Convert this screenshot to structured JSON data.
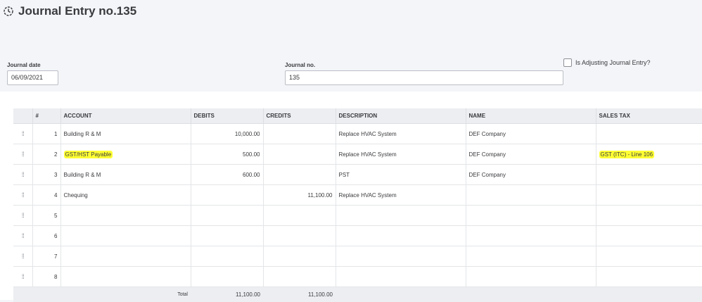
{
  "page": {
    "title": "Journal Entry no.135"
  },
  "form": {
    "journal_date_label": "Journal date",
    "journal_date_value": "06/09/2021",
    "journal_no_label": "Journal no.",
    "journal_no_value": "135",
    "adjusting_label": "Is Adjusting Journal Entry?",
    "adjusting_checked": false
  },
  "table": {
    "headers": {
      "num": "#",
      "account": "ACCOUNT",
      "debits": "DEBITS",
      "credits": "CREDITS",
      "description": "DESCRIPTION",
      "name": "NAME",
      "sales_tax": "SALES TAX"
    },
    "rows": [
      {
        "num": "1",
        "account": "Building R & M",
        "debits": "10,000.00",
        "credits": "",
        "description": "Replace HVAC System",
        "name": "DEF Company",
        "sales_tax": ""
      },
      {
        "num": "2",
        "account": "GST/HST Payable",
        "debits": "500.00",
        "credits": "",
        "description": "Replace HVAC System",
        "name": "DEF Company",
        "sales_tax": "GST (ITC) - Line 106"
      },
      {
        "num": "3",
        "account": "Building R & M",
        "debits": "600.00",
        "credits": "",
        "description": "PST",
        "name": "DEF Company",
        "sales_tax": ""
      },
      {
        "num": "4",
        "account": "Chequing",
        "debits": "",
        "credits": "11,100.00",
        "description": "Replace HVAC System",
        "name": "",
        "sales_tax": ""
      },
      {
        "num": "5",
        "account": "",
        "debits": "",
        "credits": "",
        "description": "",
        "name": "",
        "sales_tax": ""
      },
      {
        "num": "6",
        "account": "",
        "debits": "",
        "credits": "",
        "description": "",
        "name": "",
        "sales_tax": ""
      },
      {
        "num": "7",
        "account": "",
        "debits": "",
        "credits": "",
        "description": "",
        "name": "",
        "sales_tax": ""
      },
      {
        "num": "8",
        "account": "",
        "debits": "",
        "credits": "",
        "description": "",
        "name": "",
        "sales_tax": ""
      }
    ],
    "total": {
      "label": "Total",
      "debits": "11,100.00",
      "credits": "11,100.00"
    }
  },
  "icons": {
    "title_icon": "history-icon",
    "row_handle": "drag-handle-icon"
  },
  "colors": {
    "highlight": "#ffff33",
    "header_bg": "#f4f5f8",
    "table_header_bg": "#eceef1"
  }
}
